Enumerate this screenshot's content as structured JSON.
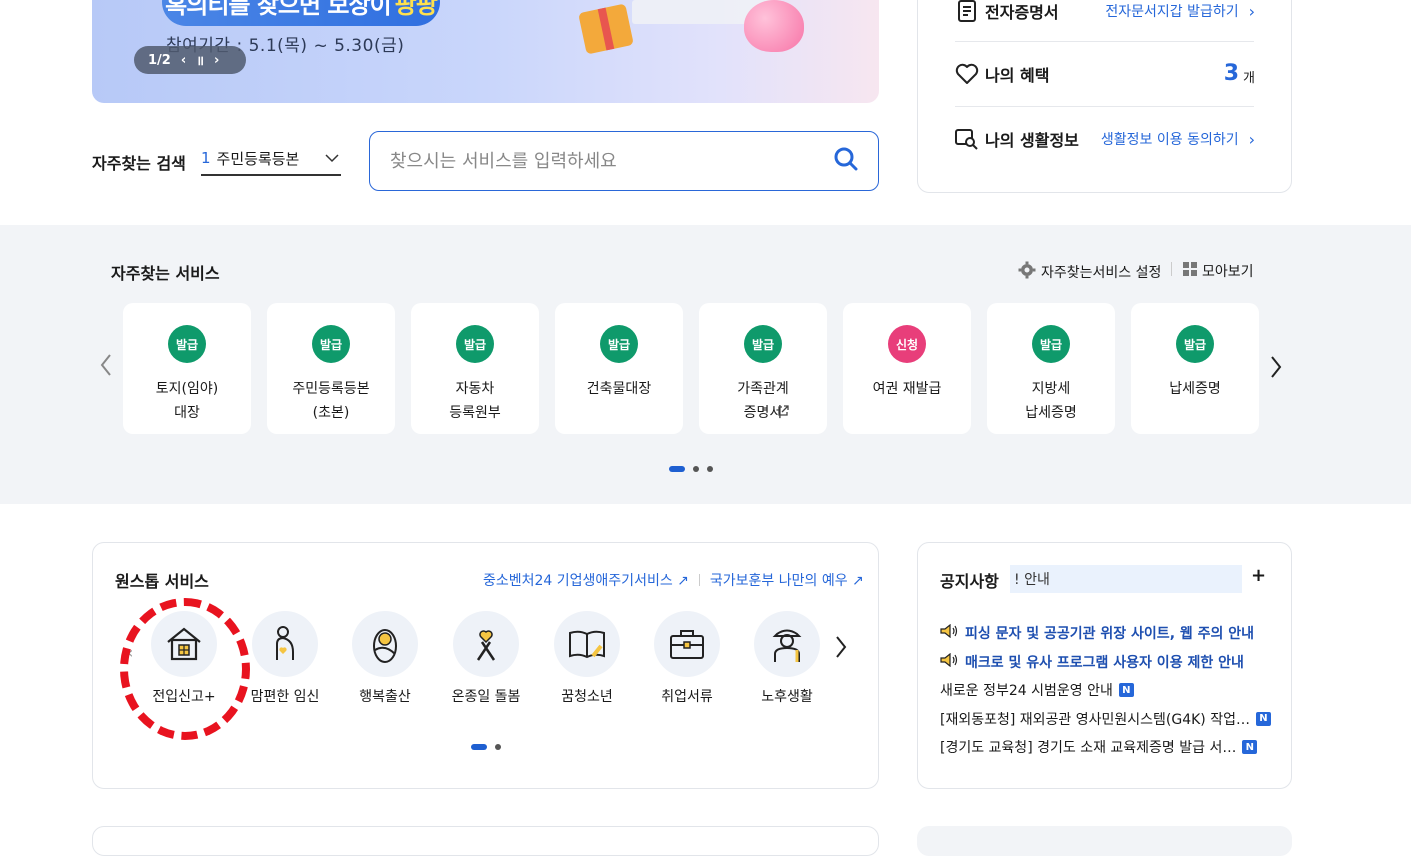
{
  "banner": {
    "headline_a": "혹의티를 찾으면 보상이",
    "headline_b": "팡팡",
    "period": "참여기간 : 5.1(목) ~ 5.30(금)",
    "pager": "1/2"
  },
  "right_panel": {
    "cert_title": "전자증명서",
    "cert_link": "전자문서지갑 발급하기",
    "benefit_title": "나의 혜택",
    "benefit_count": "3",
    "benefit_unit": "개",
    "life_title": "나의 생활정보",
    "life_link": "생활정보 이용 동의하기"
  },
  "search": {
    "freq_label": "자주찾는 검색",
    "freq_rank": "1",
    "freq_term": "주민등록등본",
    "placeholder": "찾으시는 서비스를 입력하세요"
  },
  "frequent_services": {
    "title": "자주찾는 서비스",
    "settings_label": "자주찾는서비스 설정",
    "view_all_label": "모아보기",
    "items": [
      {
        "badge": "발급",
        "name": "토지(임야)\n대장"
      },
      {
        "badge": "발급",
        "name": "주민등록등본\n(초본)"
      },
      {
        "badge": "발급",
        "name": "자동차\n등록원부"
      },
      {
        "badge": "발급",
        "name": "건축물대장"
      },
      {
        "badge": "발급",
        "name": "가족관계\n증명서"
      },
      {
        "badge": "신청",
        "name": "여권 재발급"
      },
      {
        "badge": "발급",
        "name": "지방세\n납세증명"
      },
      {
        "badge": "발급",
        "name": "납세증명"
      }
    ]
  },
  "onestop": {
    "title": "원스톱 서비스",
    "link1": "중소벤처24 기업생애주기서비스",
    "link2": "국가보훈부 나만의 예우",
    "items": [
      {
        "label": "전입신고+"
      },
      {
        "label": "맘편한 임신"
      },
      {
        "label": "행복출산"
      },
      {
        "label": "온종일 돌봄"
      },
      {
        "label": "꿈청소년"
      },
      {
        "label": "취업서류"
      },
      {
        "label": "노후생활"
      }
    ]
  },
  "notice": {
    "title": "공지사항",
    "ticker": "! 안내",
    "items": [
      {
        "text": "피싱 문자 및 공공기관 위장 사이트, 웹 주의 안내"
      },
      {
        "text": "매크로 및 유사 프로그램 사용자 이용 제한 안내"
      },
      {
        "text": "새로운 정부24 시범운영 안내",
        "new": "N"
      },
      {
        "text": "[재외동포청] 재외공관 영사민원시스템(G4K) 작업…",
        "new": "N"
      },
      {
        "text": "[경기도 교육청] 경기도 소재 교육제증명 발급 서…",
        "new": "N"
      }
    ]
  },
  "colors": {
    "accent": "#2667d9",
    "badge_green": "#0f9a6b",
    "badge_pink": "#e83e7a",
    "highlight_red": "#e8131f"
  }
}
